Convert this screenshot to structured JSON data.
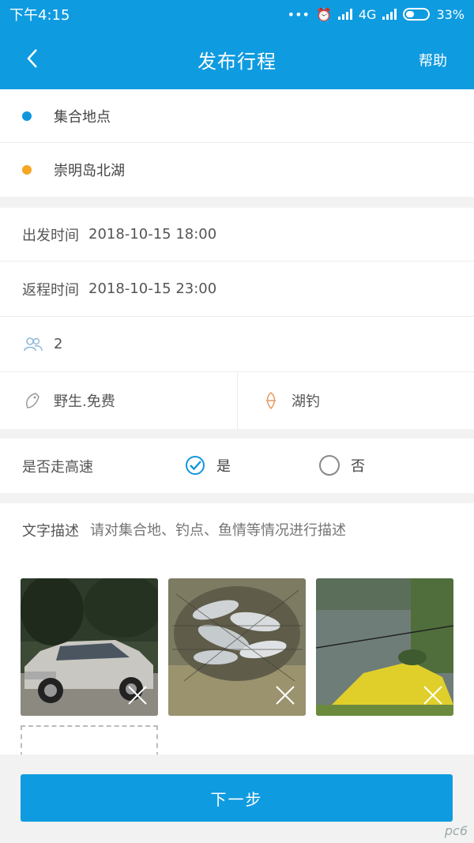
{
  "status": {
    "time": "下午4:15",
    "network": "4G",
    "battery": "33%"
  },
  "nav": {
    "title": "发布行程",
    "help": "帮助"
  },
  "locations": {
    "meet": "集合地点",
    "destination": "崇明岛北湖"
  },
  "times": {
    "depart_label": "出发时间",
    "depart_value": "2018-10-15 18:00",
    "return_label": "返程时间",
    "return_value": "2018-10-15 23:00"
  },
  "people": {
    "count": "2"
  },
  "tags": {
    "fish_type": "野生.免费",
    "fishing_type": "湖钓"
  },
  "highway": {
    "label": "是否走高速",
    "yes": "是",
    "no": "否",
    "selected": "是"
  },
  "description": {
    "label": "文字描述",
    "placeholder": "请对集合地、钓点、鱼情等情况进行描述"
  },
  "photos": [
    {
      "name": "car-photo"
    },
    {
      "name": "fish-net-photo"
    },
    {
      "name": "lake-photo"
    }
  ],
  "actions": {
    "next": "下一步"
  },
  "watermark": "pc6"
}
